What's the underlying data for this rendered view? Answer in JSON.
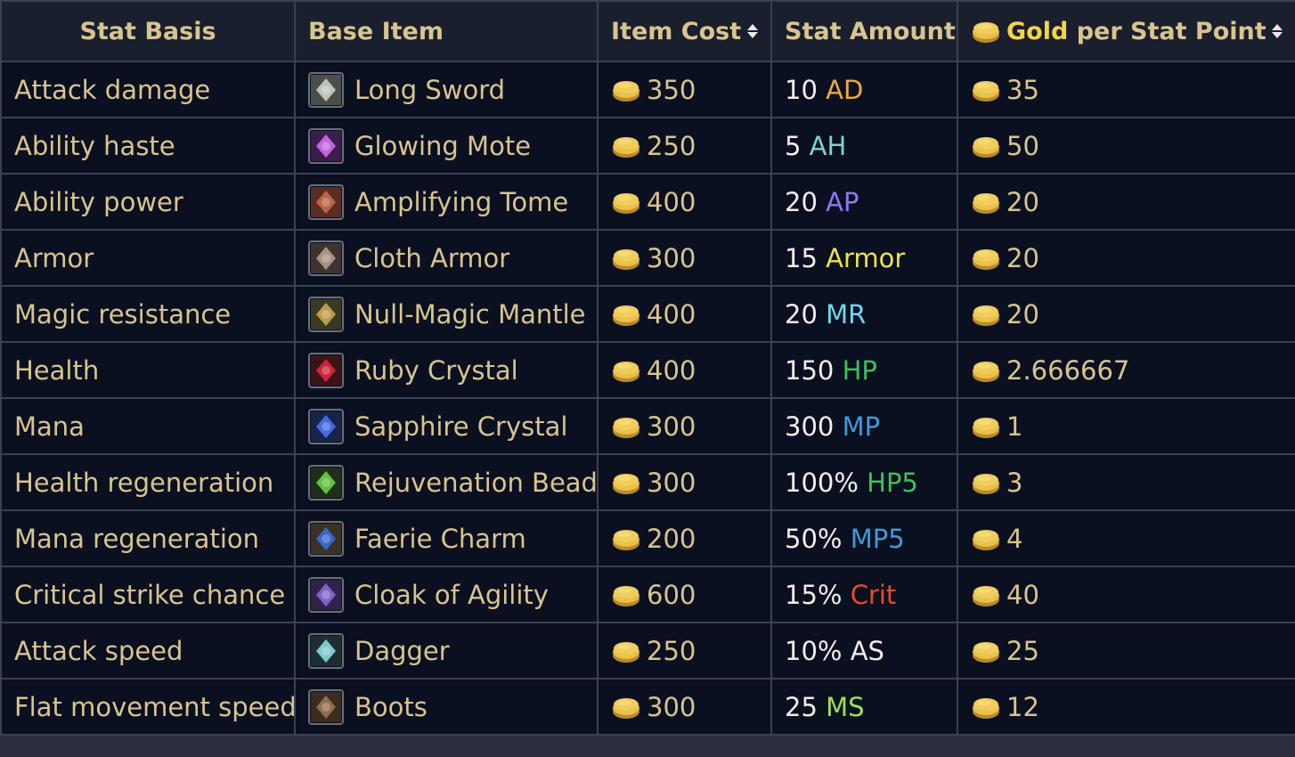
{
  "header": {
    "stat_basis": "Stat Basis",
    "base_item": "Base Item",
    "item_cost": "Item Cost",
    "stat_amount": "Stat Amount",
    "gold_word": "Gold",
    "per_stat_point": " per Stat Point"
  },
  "rows": [
    {
      "stat": "Attack damage",
      "item": "Long Sword",
      "icon": "long-sword-icon",
      "icon_bg": "#4a4f4a",
      "icon_fg": "#c9cfc6",
      "cost": "350",
      "amount": "10",
      "unit": "AD",
      "unit_color": "#f0a93c",
      "gps": "35"
    },
    {
      "stat": "Ability haste",
      "item": "Glowing Mote",
      "icon": "glowing-mote-icon",
      "icon_bg": "#3b1e4a",
      "icon_fg": "#d06cf0",
      "cost": "250",
      "amount": "5",
      "unit": "AH",
      "unit_color": "#7fd3c9",
      "gps": "50"
    },
    {
      "stat": "Ability power",
      "item": "Amplifying Tome",
      "icon": "amplifying-tome-icon",
      "icon_bg": "#5a2d24",
      "icon_fg": "#c26a4a",
      "cost": "400",
      "amount": "20",
      "unit": "AP",
      "unit_color": "#8a7cf0",
      "gps": "20"
    },
    {
      "stat": "Armor",
      "item": "Cloth Armor",
      "icon": "cloth-armor-icon",
      "icon_bg": "#3d3431",
      "icon_fg": "#b59a8c",
      "cost": "300",
      "amount": "15",
      "unit": "Armor",
      "unit_color": "#f0e24a",
      "gps": "20"
    },
    {
      "stat": "Magic resistance",
      "item": "Null-Magic Mantle",
      "icon": "null-magic-mantle-icon",
      "icon_bg": "#3a3a24",
      "icon_fg": "#c9a84a",
      "cost": "400",
      "amount": "20",
      "unit": "MR",
      "unit_color": "#6fd7f0",
      "gps": "20"
    },
    {
      "stat": "Health",
      "item": "Ruby Crystal",
      "icon": "ruby-crystal-icon",
      "icon_bg": "#3a1418",
      "icon_fg": "#e0263a",
      "cost": "400",
      "amount": "150",
      "unit": "HP",
      "unit_color": "#3fbf5a",
      "gps": "2.666667"
    },
    {
      "stat": "Mana",
      "item": "Sapphire Crystal",
      "icon": "sapphire-crystal-icon",
      "icon_bg": "#16244a",
      "icon_fg": "#4a72f0",
      "cost": "300",
      "amount": "300",
      "unit": "MP",
      "unit_color": "#3f9ad8",
      "gps": "1"
    },
    {
      "stat": "Health regeneration",
      "item": "Rejuvenation Bead",
      "icon": "rejuvenation-bead-icon",
      "icon_bg": "#1f2e1a",
      "icon_fg": "#6ad040",
      "cost": "300",
      "amount": "100%",
      "unit": "HP5",
      "unit_color": "#3fbf5a",
      "gps": "3"
    },
    {
      "stat": "Mana regeneration",
      "item": "Faerie Charm",
      "icon": "faerie-charm-icon",
      "icon_bg": "#3a3222",
      "icon_fg": "#3a6ae0",
      "cost": "200",
      "amount": "50%",
      "unit": "MP5",
      "unit_color": "#3f9ad8",
      "gps": "4"
    },
    {
      "stat": "Critical strike chance",
      "item": "Cloak of Agility",
      "icon": "cloak-of-agility-icon",
      "icon_bg": "#2e2448",
      "icon_fg": "#8a6ad8",
      "cost": "600",
      "amount": "15%",
      "unit": "Crit",
      "unit_color": "#e84a2a",
      "gps": "40"
    },
    {
      "stat": "Attack speed",
      "item": "Dagger",
      "icon": "dagger-icon",
      "icon_bg": "#1e2e30",
      "icon_fg": "#8ad8e0",
      "cost": "250",
      "amount": "10%",
      "unit": "AS",
      "unit_color": "#f0eee8",
      "gps": "25"
    },
    {
      "stat": "Flat movement speed",
      "item": "Boots",
      "icon": "boots-icon",
      "icon_bg": "#3a2c20",
      "icon_fg": "#9a7450",
      "cost": "300",
      "amount": "25",
      "unit": "MS",
      "unit_color": "#a0e050",
      "gps": "12"
    }
  ],
  "colors": {
    "gold_coin": "#e8c04a",
    "gold_text": "#d8c48e"
  }
}
